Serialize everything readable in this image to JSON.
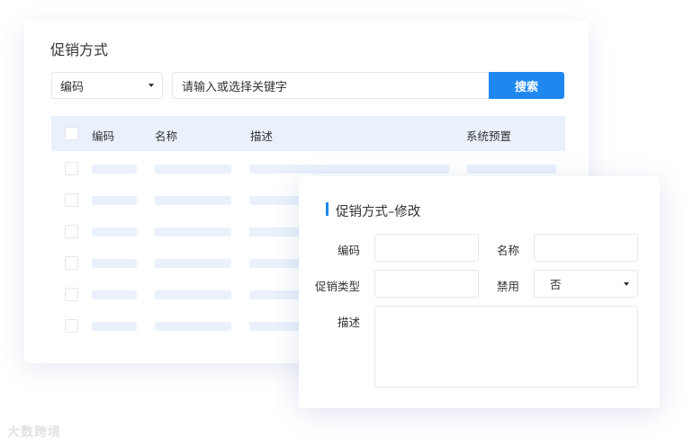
{
  "list": {
    "title": "促销方式",
    "filter_select_value": "编码",
    "search_placeholder": "请输入或选择关键字",
    "search_button": "搜索",
    "columns": [
      "编码",
      "名称",
      "描述",
      "系统预置"
    ]
  },
  "edit": {
    "title": "促销方式–修改",
    "labels": {
      "code": "编码",
      "name": "名称",
      "type": "促销类型",
      "disabled": "禁用",
      "description": "描述"
    },
    "disabled_value": "否"
  },
  "watermark": "大数跨境",
  "colors": {
    "accent": "#1e88f0",
    "header_bg": "#eaf1fc",
    "border": "#e4e7ed"
  }
}
